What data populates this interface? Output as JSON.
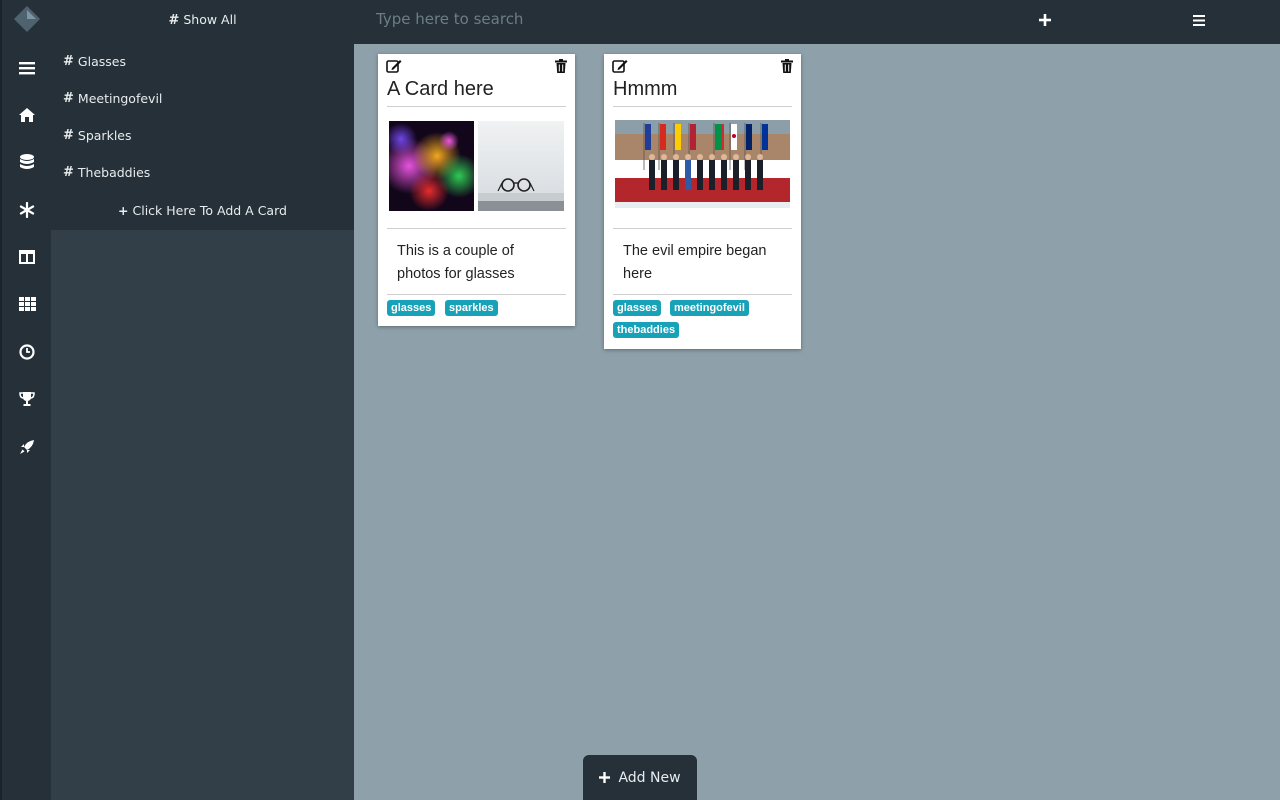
{
  "search": {
    "placeholder": "Type here to search"
  },
  "sidebar": {
    "show_all": "Show All",
    "tags": [
      "Glasses",
      "Meetingofevil",
      "Sparkles",
      "Thebaddies"
    ],
    "add_card": "Click Here To Add A Card"
  },
  "rail_icons": [
    "menu-icon",
    "home-icon",
    "database-icon",
    "snowflake-icon",
    "columns-icon",
    "grid-icon",
    "clock-icon",
    "trophy-icon",
    "rocket-icon"
  ],
  "cards": [
    {
      "title": "A Card here",
      "text": "This is a couple of photos for glasses",
      "tags": [
        "glasses",
        "sparkles"
      ]
    },
    {
      "title": "Hmmm",
      "text": "The evil empire began here",
      "tags": [
        "glasses",
        "meetingofevil",
        "thebaddies"
      ]
    }
  ],
  "footer": {
    "add_new": "Add New"
  },
  "colors": {
    "rail": "#253038",
    "panel": "#323f48",
    "canvas": "#8ea1aa",
    "tag": "#17a2b8"
  }
}
